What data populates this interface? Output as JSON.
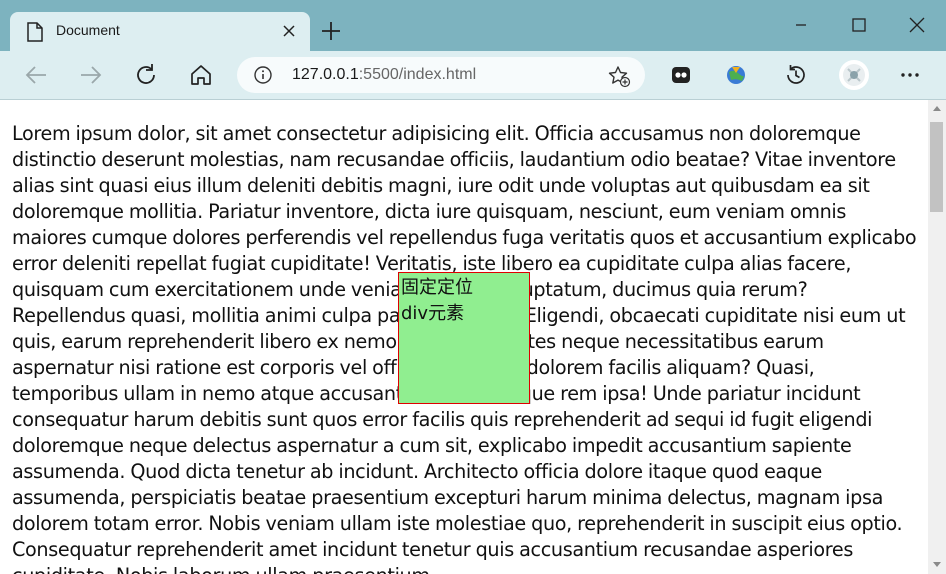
{
  "tab": {
    "title": "Document"
  },
  "addressbar": {
    "host": "127.0.0.1",
    "rest": ":5500/index.html"
  },
  "page": {
    "paragraph": "Lorem ipsum dolor, sit amet consectetur adipisicing elit. Officia accusamus non doloremque distinctio deserunt molestias, nam recusandae officiis, laudantium odio beatae? Vitae inventore alias sint quasi eius illum deleniti debitis magni, iure odit unde voluptas aut quibusdam ea sit doloremque mollitia. Pariatur inventore, dicta iure quisquam, nesciunt, eum veniam omnis maiores cumque dolores perferendis vel repellendus fuga veritatis quos et accusantium explicabo error deleniti repellat fugiat cupiditate! Veritatis, iste libero ea cupiditate culpa alias facere, quisquam cum exercitationem unde veniam odio ut voluptatum, ducimus quia rerum? Repellendus quasi, mollitia animi culpa pariatur omnis! Eligendi, obcaecati cupiditate nisi eum ut quis, earum reprehenderit libero ex nemo iusto, voluptates neque necessitatibus earum aspernatur nisi ratione est corporis vel officia inventore dolorem facilis aliquam? Quasi, temporibus ullam in nemo atque accusantium doloremque rem ipsa! Unde pariatur incidunt consequatur harum debitis sunt quos error facilis quis reprehenderit ad sequi id fugit eligendi doloremque neque delectus aspernatur a cum sit, explicabo impedit accusantium sapiente assumenda. Quod dicta tenetur ab incidunt. Architecto officia dolore itaque quod eaque assumenda, perspiciatis beatae praesentium excepturi harum minima delectus, magnam ipsa dolorem totam error. Nobis veniam ullam iste molestiae quo, reprehenderit in suscipit eius optio. Consequatur reprehenderit amet incidunt tenetur quis accusantium recusandae asperiores cupiditate. Nobis laborum ullam praesentium",
    "fixed_box_line1": "固定定位",
    "fixed_box_line2": "div元素"
  },
  "colors": {
    "titlebar": "#7db3bf",
    "toolbar": "#ddeef1",
    "fixed_box_bg": "#90ee90",
    "fixed_box_border": "#e00000"
  },
  "icons": [
    "page-icon",
    "close-icon",
    "plus-icon",
    "minimize-icon",
    "maximize-icon",
    "window-close-icon",
    "back-icon",
    "forward-icon",
    "refresh-icon",
    "home-icon",
    "info-icon",
    "add-favorite-icon",
    "extension-icon",
    "extension-globe-icon",
    "history-icon",
    "profile-icon",
    "more-icon"
  ]
}
